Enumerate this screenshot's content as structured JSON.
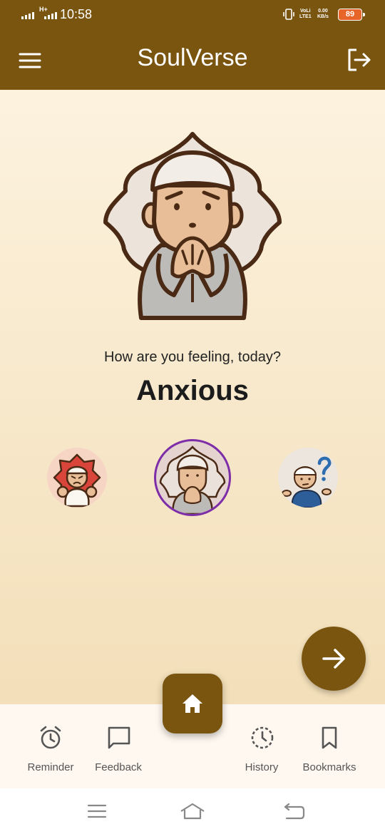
{
  "status_bar": {
    "time": "10:58",
    "network": "H+",
    "volte_line1": "VoLi",
    "volte_line2": "LTE1",
    "speed_value": "0.00",
    "speed_unit": "KB/s",
    "battery": "89"
  },
  "app_bar": {
    "title": "SoulVerse",
    "menu_icon": "hamburger-menu-icon",
    "logout_icon": "logout-icon"
  },
  "main": {
    "question": "How are you feeling, today?",
    "selected_mood": "Anxious",
    "mood_options": [
      {
        "mood": "angry",
        "selected": false
      },
      {
        "mood": "anxious",
        "selected": true
      },
      {
        "mood": "confused",
        "selected": false
      }
    ],
    "next_icon": "arrow-right-icon"
  },
  "bottom_nav": {
    "items": [
      {
        "label": "Reminder",
        "icon": "alarm-clock-icon"
      },
      {
        "label": "Feedback",
        "icon": "chat-bubble-icon"
      },
      {
        "label": "History",
        "icon": "history-clock-icon"
      },
      {
        "label": "Bookmarks",
        "icon": "bookmark-icon"
      }
    ],
    "home_icon": "home-icon"
  },
  "colors": {
    "brand": "#7A5510",
    "selected_ring": "#7E2DA8",
    "battery": "#E8652A"
  }
}
